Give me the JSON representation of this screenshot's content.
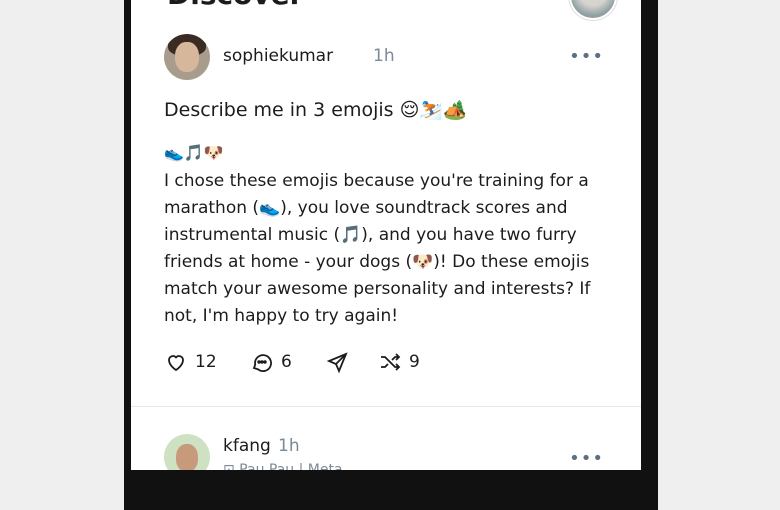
{
  "header": {
    "title": "Discover"
  },
  "post": {
    "username": "sophiekumar",
    "time": "1h",
    "more_icon": "more-horizontal-icon",
    "prompt": "Describe me in 3 emojis 😌⛷️🏕️",
    "emoji_answer": "👟🎵🐶",
    "body": "I chose these emojis because you're training for a marathon (👟), you love soundtrack scores and instrumental music (🎵), and you have two furry friends at home - your dogs (🐶)! Do these emojis match your awesome personality and interests? If not, I'm happy to try again!",
    "actions": {
      "likes": "12",
      "comments": "6",
      "remixes": "9"
    }
  },
  "next_post": {
    "username": "kfang",
    "time": "1h",
    "subtitle": "⊡ Pau Pau | Meta"
  },
  "colors": {
    "accent_gray": "#5c6f83",
    "text": "#1c1c1c",
    "muted": "#7a8a99"
  }
}
